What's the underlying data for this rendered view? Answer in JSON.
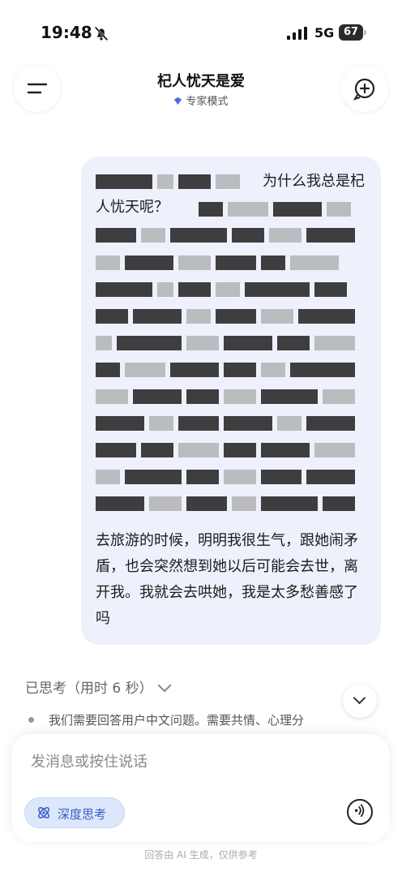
{
  "status": {
    "time": "19:48",
    "network": "5G",
    "battery": "67"
  },
  "header": {
    "title": "杞人忧天是爱",
    "mode": "专家模式"
  },
  "message": {
    "line1": "为什么我总是杞人忧天呢？",
    "line2": "去旅游的时候，明明我很生气，跟她闹矛盾，也会突然想到她以后可能会去世，离开我。我就会去哄她，我是太多愁善感了吗"
  },
  "thinking": {
    "header": "已思考（用时 6 秒）",
    "summary": "我们需要回答用户中文问题。需要共情、心理分"
  },
  "composer": {
    "placeholder": "发消息或按住说话",
    "deep_think_label": "深度思考"
  },
  "footer": "回答由 AI 生成，仅供参考",
  "colors": {
    "bubble": "#eef1fb",
    "accent": "#3a5bc8"
  },
  "icons": [
    "menu-icon",
    "new-chat-icon",
    "expert-mode-icon",
    "chevron-down-icon",
    "atom-icon",
    "voice-icon",
    "mute-bell-icon",
    "signal-icon",
    "battery-icon"
  ]
}
